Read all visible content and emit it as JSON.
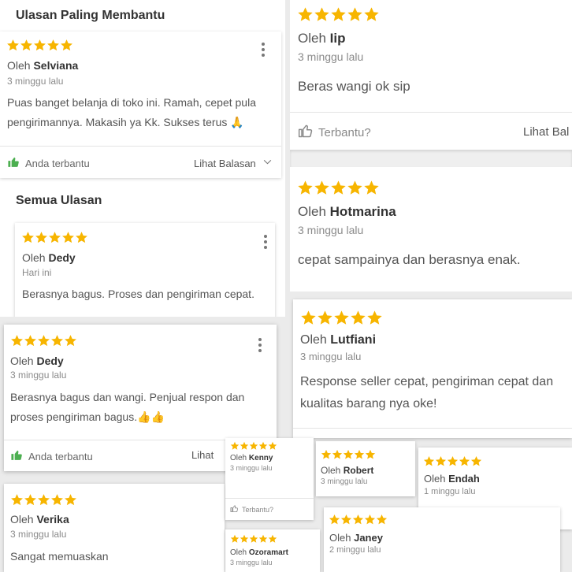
{
  "colors": {
    "star": "#f7b500",
    "helpful": "#4caf50",
    "muted": "#8a8a8a"
  },
  "icons": {
    "star": "star-icon",
    "kebab": "more-vertical-icon",
    "thumb_filled": "thumbs-up-filled-icon",
    "thumb_outline": "thumbs-up-outline-icon",
    "chevron": "chevron-down-icon"
  },
  "rating": 5,
  "top_panel": {
    "title": "Ulasan Paling Membantu",
    "review": {
      "by": "Oleh",
      "name": "Selviana",
      "time": "3 minggu lalu",
      "text": "Puas banget belanja di toko ini. Ramah, cepet pula pengirimannya. Makasih ya Kk. Sukses terus 🙏",
      "helpful_label": "Anda terbantu",
      "replies_label": "Lihat Balasan"
    },
    "all_reviews_title": "Semua Ulasan",
    "review2": {
      "by": "Oleh",
      "name": "Dedy",
      "time": "Hari ini",
      "text": "Berasnya bagus. Proses dan pengiriman cepat."
    }
  },
  "dedy_card": {
    "by": "Oleh",
    "name": "Dedy",
    "time": "3 minggu lalu",
    "text": "Berasnya bagus dan wangi. Penjual respon dan proses pengiriman bagus.👍👍",
    "helpful_label": "Anda terbantu",
    "replies_label": "Lihat"
  },
  "verika_card": {
    "by": "Oleh",
    "name": "Verika",
    "time": "3 minggu lalu",
    "text": "Sangat memuaskan"
  },
  "right_panel": {
    "iip": {
      "by": "Oleh",
      "name": "Iip",
      "time": "3 minggu lalu",
      "text": "Beras wangi ok sip",
      "helpful_label": "Terbantu?",
      "replies_label": "Lihat Bal"
    },
    "hotmarina": {
      "by": "Oleh",
      "name": "Hotmarina",
      "time": "3 minggu lalu",
      "text": "cepat sampainya dan berasnya enak."
    }
  },
  "lutfiani_card": {
    "by": "Oleh",
    "name": "Lutfiani",
    "time": "3 minggu lalu",
    "text": "Response seller cepat, pengiriman cepat dan kualitas barang nya oke!"
  },
  "mini_cards": {
    "kenny": {
      "by": "Oleh",
      "name": "Kenny",
      "time": "3 minggu lalu",
      "helpful_label": "Terbantu?"
    },
    "robert": {
      "by": "Oleh",
      "name": "Robert",
      "time": "3 minggu lalu"
    },
    "endah": {
      "by": "Oleh",
      "name": "Endah",
      "time": "1 minggu lalu"
    },
    "ozoramart": {
      "by": "Oleh",
      "name": "Ozoramart",
      "time": "3 minggu lalu"
    },
    "janey": {
      "by": "Oleh",
      "name": "Janey",
      "time": "2 minggu lalu"
    }
  }
}
